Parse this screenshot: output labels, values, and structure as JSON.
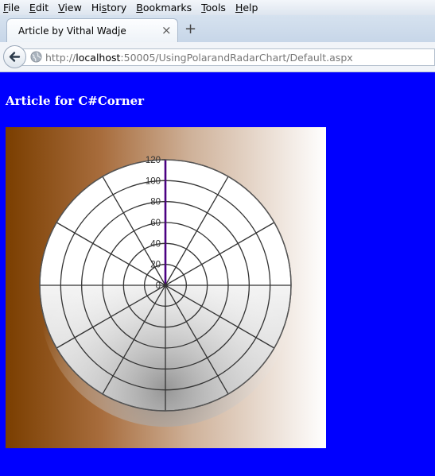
{
  "menubar": {
    "items": [
      {
        "label": "File",
        "acc": "F",
        "rest": "ile"
      },
      {
        "label": "Edit",
        "acc": "E",
        "rest": "dit"
      },
      {
        "label": "View",
        "acc": "V",
        "rest": "iew"
      },
      {
        "label": "History",
        "pre": "Hi",
        "acc": "s",
        "rest": "tory"
      },
      {
        "label": "Bookmarks",
        "acc": "B",
        "rest": "ookmarks"
      },
      {
        "label": "Tools",
        "acc": "T",
        "rest": "ools"
      },
      {
        "label": "Help",
        "acc": "H",
        "rest": "elp"
      }
    ]
  },
  "tab": {
    "title": "Article by Vithal Wadje",
    "close_glyph": "×",
    "new_tab_glyph": "+"
  },
  "urlbar": {
    "prefix": "http://",
    "host": "localhost",
    "rest": ":50005/UsingPolarandRadarChart/Default.aspx"
  },
  "page": {
    "heading": "Article for C#Corner"
  },
  "chart_data": {
    "type": "polar",
    "title": "",
    "series": [],
    "radial_ticks": [
      "0",
      "20",
      "40",
      "60",
      "80",
      "100",
      "120"
    ],
    "radial_range": [
      0,
      120
    ],
    "angular_divisions": 12,
    "grid": true,
    "colors": {
      "panel_left": "#7a3e00",
      "panel_right": "#ffffff",
      "axis_highlight": "#4b0082",
      "gridline": "#333333"
    }
  }
}
